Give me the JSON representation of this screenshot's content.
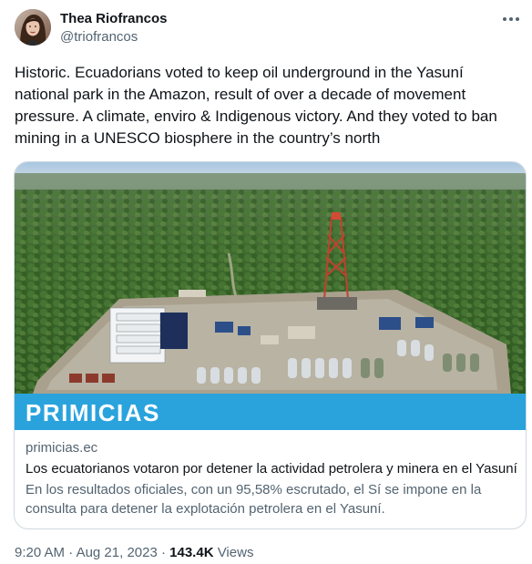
{
  "author": {
    "name": "Thea Riofrancos",
    "handle": "@triofrancos"
  },
  "tweet": {
    "text": "Historic. Ecuadorians voted to keep oil underground in the Yasuní national park in the Amazon, result of over a decade of movement pressure. A climate, enviro & Indigenous victory. And they voted to ban mining in a UNESCO biosphere in the country’s north"
  },
  "card": {
    "brand": "PRIMICIAS",
    "domain": "primicias.ec",
    "title": "Los ecuatorianos votaron por detener la actividad petrolera y minera en el Yasuní",
    "description": "En los resultados oficiales, con un 95,58% escrutado, el Sí se impone en la consulta para detener la explotación petrolera en el Yasuní."
  },
  "meta": {
    "time": "9:20 AM",
    "separator": "·",
    "date": "Aug 21, 2023",
    "views_count": "143.4K",
    "views_label": "Views"
  },
  "colors": {
    "brand_bar": "#2aa3dd",
    "secondary_text": "#536471",
    "primary_text": "#0f1419",
    "border": "#cfd9de"
  },
  "icons": {
    "more": "more-horizontal-icon"
  }
}
